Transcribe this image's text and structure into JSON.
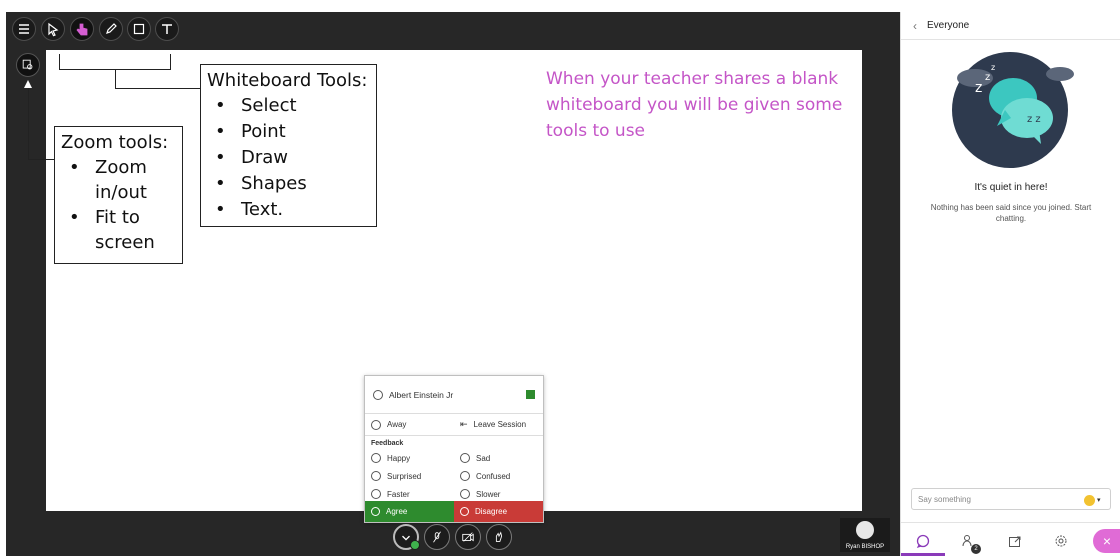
{
  "toolbar": {
    "tools": [
      "menu",
      "select",
      "point",
      "draw",
      "shape",
      "text"
    ]
  },
  "whiteboard": {
    "tools_box": {
      "title": "Whiteboard Tools:",
      "items": [
        "Select",
        "Point",
        "Draw",
        "Shapes",
        "Text."
      ]
    },
    "zoom_box": {
      "title": "Zoom tools:",
      "items": [
        "Zoom in/out",
        "Fit to screen"
      ]
    },
    "teacher_note": "When your teacher shares a blank whiteboard you will be given some tools to use"
  },
  "status_menu": {
    "user_name": "Albert Einstein Jr",
    "away": "Away",
    "leave": "Leave Session",
    "feedback_label": "Feedback",
    "feedback": [
      {
        "left": "Happy",
        "right": "Sad"
      },
      {
        "left": "Surprised",
        "right": "Confused"
      },
      {
        "left": "Faster",
        "right": "Slower"
      }
    ],
    "agree": "Agree",
    "disagree": "Disagree"
  },
  "user_chip": {
    "name": "Ryan BISHOP"
  },
  "panel": {
    "title": "Everyone",
    "quiet_title": "It's quiet in here!",
    "quiet_sub": "Nothing has been said since you joined. Start chatting.",
    "input_placeholder": "Say something",
    "badge_count": "2"
  },
  "colors": {
    "accent": "#8a3ab9",
    "agree": "#2e8b2e",
    "disagree": "#c93b37",
    "note_text": "#c455c7"
  }
}
